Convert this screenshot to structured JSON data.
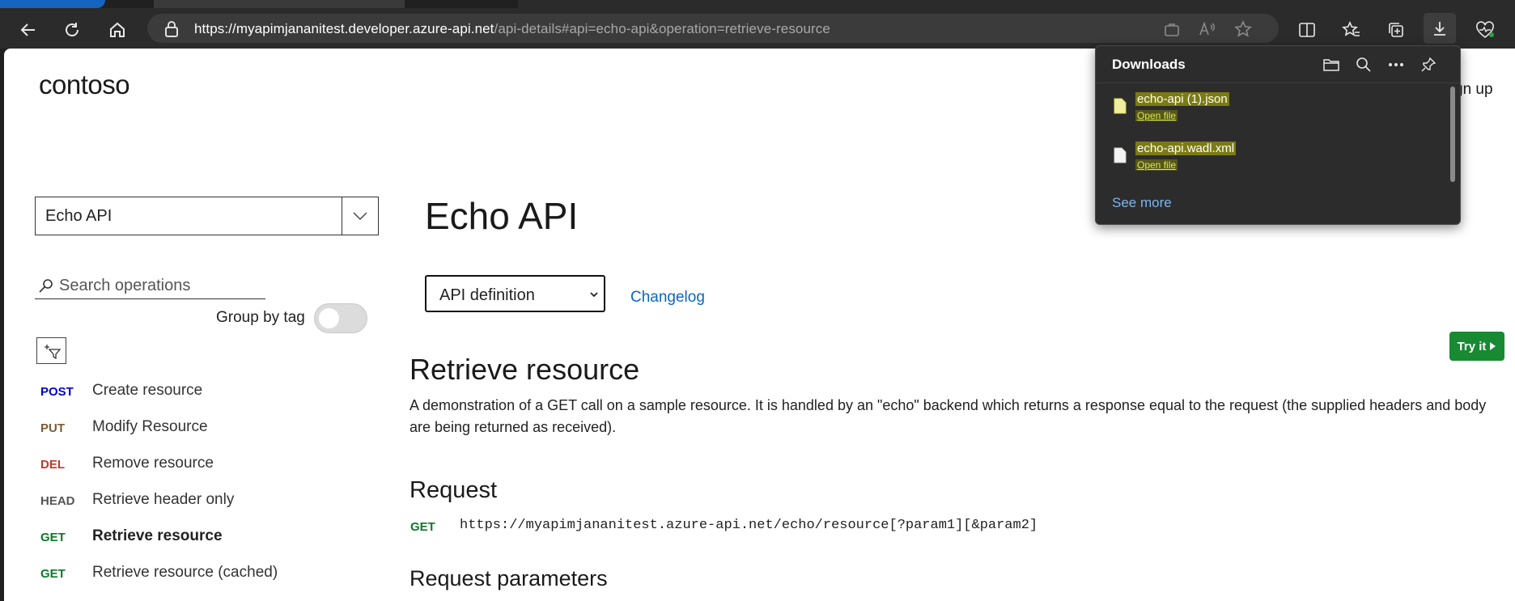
{
  "browser": {
    "url_host": "https://myapimjananitest.developer.azure-api.net",
    "url_path": "/api-details#api=echo-api&operation=retrieve-resource"
  },
  "header": {
    "logo": "contoso",
    "signup_partial": "gn up"
  },
  "sidebar": {
    "api_select": "Echo API",
    "search_placeholder": "Search operations",
    "group_by_tag": "Group by tag",
    "group_by_tag_on": false,
    "operations": [
      {
        "method": "POST",
        "name": "Create resource",
        "selected": false
      },
      {
        "method": "PUT",
        "name": "Modify Resource",
        "selected": false
      },
      {
        "method": "DEL",
        "name": "Remove resource",
        "selected": false
      },
      {
        "method": "HEAD",
        "name": "Retrieve header only",
        "selected": false
      },
      {
        "method": "GET",
        "name": "Retrieve resource",
        "selected": true
      },
      {
        "method": "GET",
        "name": "Retrieve resource (cached)",
        "selected": false
      }
    ]
  },
  "main": {
    "api_title": "Echo API",
    "definition_select": "API definition",
    "changelog": "Changelog",
    "try_it": "Try it",
    "operation_title": "Retrieve resource",
    "operation_description": "A demonstration of a GET call on a sample resource. It is handled by an \"echo\" backend which returns a response equal to the request (the supplied headers and body are being returned as received).",
    "request_title": "Request",
    "request_method": "GET",
    "request_url": "https://myapimjananitest.azure-api.net/echo/resource[?param1][&param2]",
    "request_params_title": "Request parameters"
  },
  "downloads": {
    "title": "Downloads",
    "items": [
      {
        "name": "echo-api (1).json",
        "action": "Open file"
      },
      {
        "name": "echo-api.wadl.xml",
        "action": "Open file"
      }
    ],
    "see_more": "See more"
  },
  "colors": {
    "accent_link": "#0a66c2",
    "try_it": "#178a32",
    "get_method": "#0c7a2a",
    "post_method": "#0000cc"
  }
}
